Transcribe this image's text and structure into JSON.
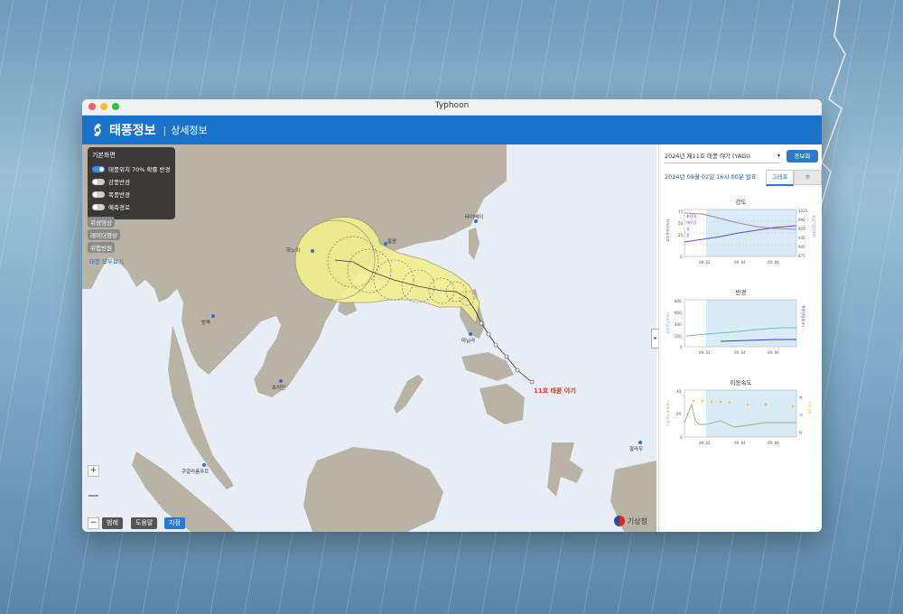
{
  "window": {
    "title": "Typhoon"
  },
  "app": {
    "title": "태풍정보",
    "subtitle": "상세정보"
  },
  "panel": {
    "heading": "기본화면",
    "toggles": [
      {
        "label": "태풍위치 70% 확률 반경",
        "on": true
      },
      {
        "label": "강풍반경",
        "on": false
      },
      {
        "label": "폭풍반경",
        "on": false
      },
      {
        "label": "예측경로",
        "on": false
      }
    ]
  },
  "chips": [
    "위성영상",
    "레이더영상",
    "위험반원"
  ],
  "show_all": "태풍 모두보기",
  "bottom_buttons": [
    "범례",
    "도움말",
    "지점"
  ],
  "zoom": {
    "in": "+",
    "out": "−"
  },
  "map": {
    "storm_label": "11호 태풍 야기",
    "agency": "기상청",
    "cities": [
      "타이베이",
      "마닐라",
      "하노이",
      "홍콩",
      "방콕",
      "호치민",
      "쿠알라룸푸르",
      "팔라우"
    ]
  },
  "sidebar": {
    "typhoon_select": "2024년 제11호 태풍 야기 (YAGI)",
    "detail_button": "종보화",
    "issued": "2024년 09월 02일 16시 00분 발표",
    "tabs": [
      "그래프",
      "≡"
    ],
    "charts": [
      {
        "title": "강도",
        "ylabel_left": "최대풍속(m/s)",
        "ylabel_right": "중심기압(hPa)",
        "legend": [
          "초강력",
          "매우강",
          "강",
          "중"
        ],
        "y_left_ticks": [
          "75",
          "50",
          "25",
          "0"
        ],
        "y_right_ticks": [
          "1025",
          "990",
          "960",
          "930",
          "900",
          "875"
        ],
        "x_ticks": [
          "09. 02",
          "09. 04",
          "09. 06"
        ]
      },
      {
        "title": "반경",
        "ylabel_left": "강풍반경(km)",
        "ylabel_right": "폭풍반경(km)",
        "y_left_ticks": [
          "800",
          "600",
          "400",
          "200",
          "0"
        ],
        "x_ticks": [
          "09. 02",
          "09. 04",
          "09. 06"
        ]
      },
      {
        "title": "이동속도",
        "ylabel_left": "이동속도(km/h)",
        "ylabel_right": "이동방향",
        "y_left_ticks": [
          "40",
          "20",
          "0"
        ],
        "direction_labels": [
          "북",
          "서",
          "남"
        ],
        "x_ticks": [
          "09. 02",
          "09. 04",
          "09. 06"
        ]
      }
    ]
  },
  "colors": {
    "accent": "#1a73c9",
    "cone": "#f2ef8e",
    "track_label": "#e03a1a",
    "land": "#b7b1a4",
    "sea": "#e8eef6"
  }
}
